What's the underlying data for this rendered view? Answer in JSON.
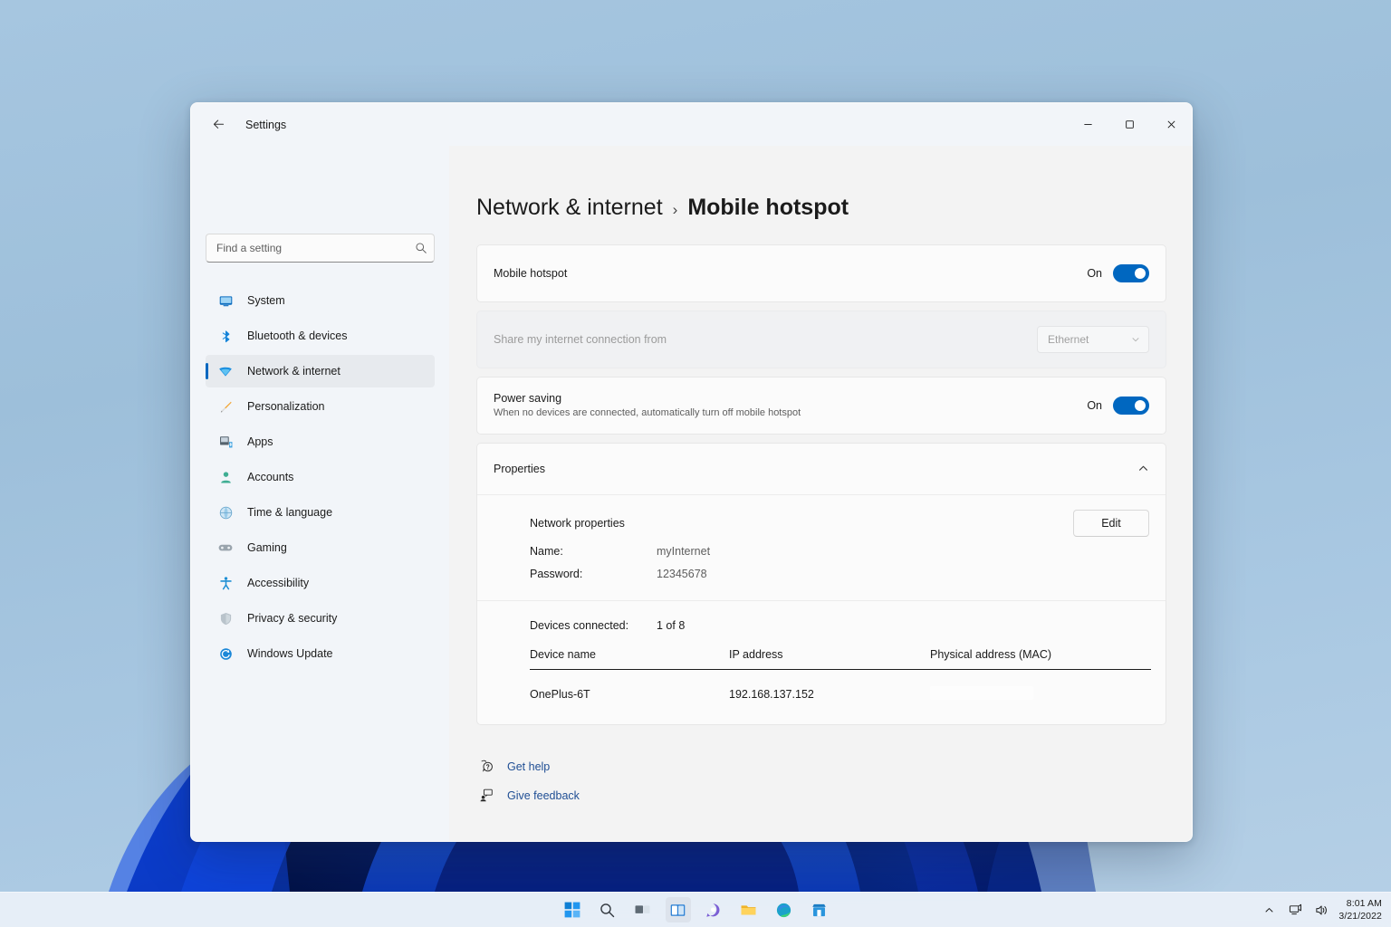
{
  "window": {
    "app_title": "Settings",
    "back_icon": "back-arrow-icon",
    "minimize_label": "Minimize",
    "maximize_label": "Maximize",
    "close_label": "Close"
  },
  "search": {
    "placeholder": "Find a setting",
    "value": "",
    "icon": "search-icon"
  },
  "sidebar": {
    "items": [
      {
        "label": "System",
        "icon": "monitor-icon",
        "selected": false
      },
      {
        "label": "Bluetooth & devices",
        "icon": "bluetooth-icon",
        "selected": false
      },
      {
        "label": "Network & internet",
        "icon": "wifi-icon",
        "selected": true
      },
      {
        "label": "Personalization",
        "icon": "paintbrush-icon",
        "selected": false
      },
      {
        "label": "Apps",
        "icon": "apps-grid-icon",
        "selected": false
      },
      {
        "label": "Accounts",
        "icon": "person-icon",
        "selected": false
      },
      {
        "label": "Time & language",
        "icon": "globe-clock-icon",
        "selected": false
      },
      {
        "label": "Gaming",
        "icon": "gamepad-icon",
        "selected": false
      },
      {
        "label": "Accessibility",
        "icon": "accessibility-person-icon",
        "selected": false
      },
      {
        "label": "Privacy & security",
        "icon": "shield-icon",
        "selected": false
      },
      {
        "label": "Windows Update",
        "icon": "update-refresh-icon",
        "selected": false
      }
    ]
  },
  "breadcrumb": {
    "parent": "Network & internet",
    "separator": "›",
    "current": "Mobile hotspot"
  },
  "hotspot_card": {
    "title": "Mobile hotspot",
    "state_label": "On",
    "toggle_on": true
  },
  "share_card": {
    "title": "Share my internet connection from",
    "disabled": true,
    "select_value": "Ethernet",
    "select_icon": "chevron-down-icon"
  },
  "power_saving_card": {
    "title": "Power saving",
    "subtitle": "When no devices are connected, automatically turn off mobile hotspot",
    "state_label": "On",
    "toggle_on": true
  },
  "properties_card": {
    "header": "Properties",
    "expand_icon": "chevron-up-icon",
    "expanded": true,
    "network_properties_label": "Network properties",
    "edit_button": "Edit",
    "name_label": "Name:",
    "name_value": "myInternet",
    "password_label": "Password:",
    "password_value": "12345678",
    "devices_connected_label": "Devices connected:",
    "devices_connected_value": "1 of 8",
    "table": {
      "columns": [
        "Device name",
        "IP address",
        "Physical address (MAC)"
      ],
      "rows": [
        {
          "device_name": "OnePlus-6T",
          "ip_address": "192.168.137.152",
          "mac": ""
        }
      ]
    }
  },
  "footer": {
    "links": [
      {
        "label": "Get help",
        "icon": "help-question-icon"
      },
      {
        "label": "Give feedback",
        "icon": "feedback-icon"
      }
    ]
  },
  "taskbar": {
    "buttons": [
      {
        "name": "start-icon",
        "label": "Start"
      },
      {
        "name": "search-icon",
        "label": "Search"
      },
      {
        "name": "task-view-icon",
        "label": "Task view"
      },
      {
        "name": "widgets-icon",
        "label": "Widgets"
      },
      {
        "name": "chat-icon",
        "label": "Chat"
      },
      {
        "name": "file-explorer-icon",
        "label": "File Explorer"
      },
      {
        "name": "edge-browser-icon",
        "label": "Microsoft Edge"
      },
      {
        "name": "microsoft-store-icon",
        "label": "Microsoft Store"
      }
    ],
    "tray": {
      "chevron_icon": "chevron-up-icon",
      "network_icon": "network-icon",
      "volume_icon": "volume-icon",
      "time": "8:01 AM",
      "date": "3/21/2022"
    }
  },
  "colors": {
    "accent": "#0067C0",
    "link": "#1F4E94",
    "window_bg": "#F3F3F3",
    "card_bg": "#FBFBFB",
    "desktop": "#9FC0DC"
  }
}
